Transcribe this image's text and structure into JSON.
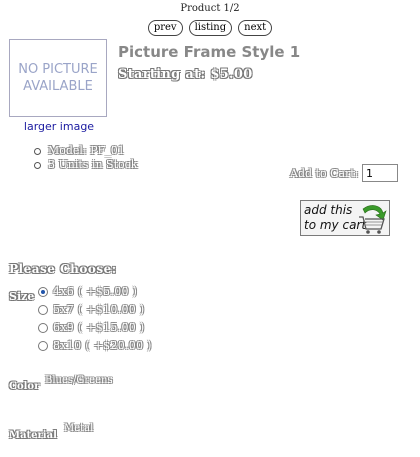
{
  "navigation": {
    "product_counter": "Product 1/2",
    "prev_label": "prev",
    "listing_label": "listing",
    "next_label": "next"
  },
  "product": {
    "no_picture_line1": "NO PICTURE",
    "no_picture_line2": "AVAILABLE",
    "larger_image_link": "larger image",
    "title": "Picture Frame Style 1",
    "price": "Starting at: $5.00",
    "model": "Model: PF_01",
    "stock": "3 Units in Stock"
  },
  "cart": {
    "add_label": "Add to Cart:",
    "quantity": "1",
    "button_line1": "add this",
    "button_line2": "to my cart"
  },
  "attributes": {
    "heading": "Please Choose:",
    "size_label": "Size",
    "size_options": [
      {
        "label": "4x6 ( +$5.00 )",
        "selected": true
      },
      {
        "label": "5x7 ( +$10.00 )",
        "selected": false
      },
      {
        "label": "6x9 ( +$15.00 )",
        "selected": false
      },
      {
        "label": "8x10 ( +$20.00 )",
        "selected": false
      }
    ],
    "color_label": "Color",
    "color_value": "Blues/Greens",
    "material_label": "Material",
    "material_value": "Metal"
  },
  "colors": {
    "link": "#1a1aa0",
    "title": "#888888",
    "no_picture_text": "#9aa4c8",
    "cart_arrow": "#3a9a2a"
  },
  "icons": {
    "cart": "shopping-cart-icon",
    "arrow": "green-arrow-icon"
  }
}
